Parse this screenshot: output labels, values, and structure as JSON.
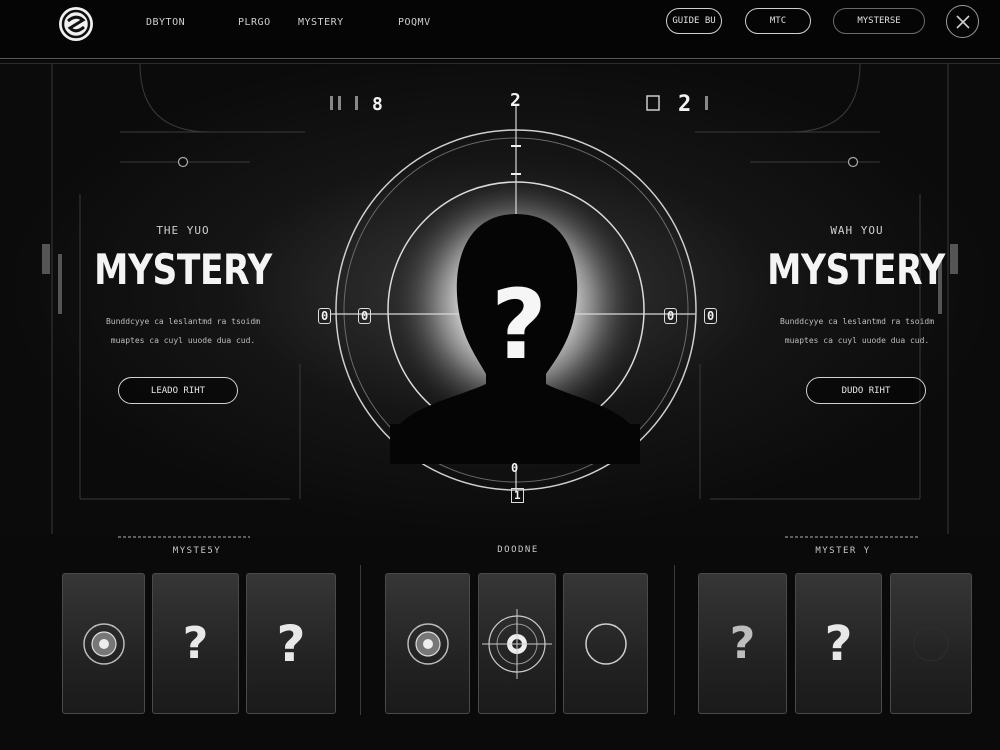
{
  "header": {
    "nav": [
      "DBYTON",
      "PLRGO",
      "MYSTERY",
      "POQMV"
    ],
    "pills": [
      "GUIDE BU",
      "MTC",
      "MYSTERSE"
    ]
  },
  "hud": {
    "top_left_num": "8",
    "top_center_num": "2",
    "top_right_num": "2",
    "left_marker": "0",
    "left_marker2": "0",
    "right_marker": "0",
    "right_marker2": "0",
    "bottom_num": "0",
    "bottom_small": "1",
    "center_symbol": "?"
  },
  "left_panel": {
    "subtitle": "THE YUO",
    "title": "MYSTERY",
    "desc_line1": "Bunddcyye ca leslantmd ra tsoidm",
    "desc_line2": "muaptes ca cuyl uuode dua cud.",
    "button": "LEADO RIHT"
  },
  "right_panel": {
    "subtitle": "WAH YOU",
    "title": "MYSTERY",
    "desc_line1": "Bunddcyye ca leslantmd ra tsoidm",
    "desc_line2": "muaptes ca cuyl uuode dua cud.",
    "button": "DUDO RIHT"
  },
  "sections": [
    {
      "label": "MYSTE5Y"
    },
    {
      "label": "DOODNE"
    },
    {
      "label": "MYSTER Y"
    }
  ],
  "cards": [
    {
      "icon": "target-icon",
      "symbol": ""
    },
    {
      "icon": "question-icon",
      "symbol": "?"
    },
    {
      "icon": "question-icon",
      "symbol": "?"
    },
    {
      "icon": "target-icon",
      "symbol": ""
    },
    {
      "icon": "crosshair-icon",
      "symbol": ""
    },
    {
      "icon": "ring-icon",
      "symbol": ""
    },
    {
      "icon": "question-icon",
      "symbol": "?"
    },
    {
      "icon": "question-icon",
      "symbol": "?"
    },
    {
      "icon": "blank",
      "symbol": ""
    }
  ],
  "colors": {
    "background": "#0a0a0a",
    "accent": "#f2f2f2",
    "line": "#3b3b3b"
  }
}
